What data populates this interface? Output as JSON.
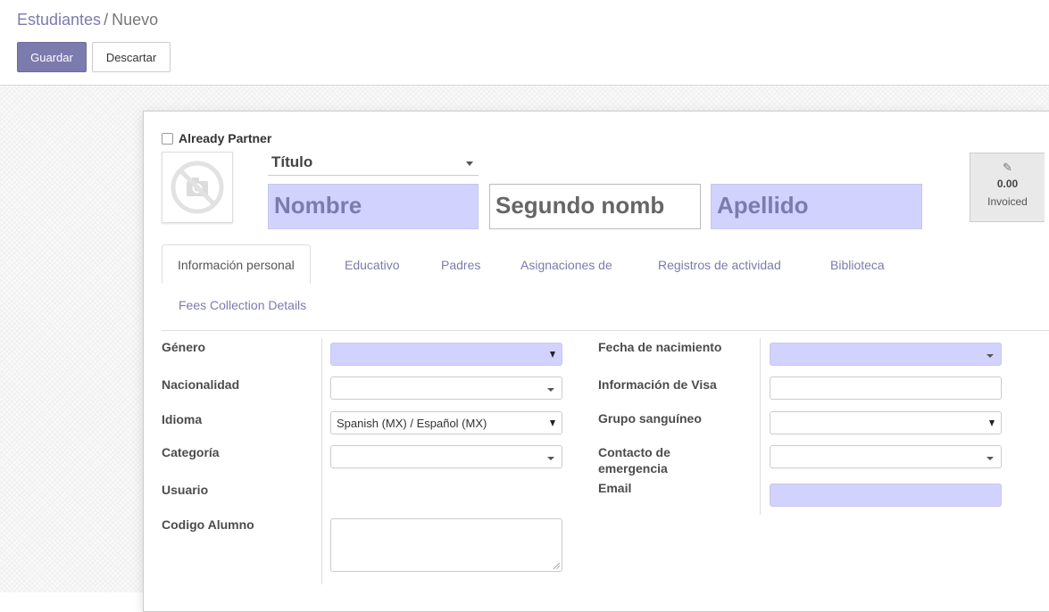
{
  "breadcrumb": {
    "parent": "Estudiantes",
    "separator": "/",
    "current": "Nuevo"
  },
  "toolbar": {
    "save_label": "Guardar",
    "discard_label": "Descartar"
  },
  "form": {
    "already_partner_label": "Already Partner",
    "already_partner_checked": false,
    "title_value": "Título",
    "first_name_placeholder": "Nombre",
    "middle_name_placeholder": "Segundo nomb",
    "last_name_placeholder": "Apellido",
    "stat": {
      "icon": "edit-icon",
      "value": "0.00",
      "label": "Invoiced"
    }
  },
  "tabs": [
    {
      "label": "Información personal",
      "active": true
    },
    {
      "label": "Educativo"
    },
    {
      "label": "Padres"
    },
    {
      "label": "Asignaciones de"
    },
    {
      "label": "Registros de actividad"
    },
    {
      "label": "Biblioteca"
    },
    {
      "label": "Fees Collection Details"
    }
  ],
  "left_fields": {
    "genero": {
      "label": "Género",
      "value": ""
    },
    "nacionalidad": {
      "label": "Nacionalidad",
      "value": ""
    },
    "idioma": {
      "label": "Idioma",
      "value": "Spanish (MX) / Español (MX)"
    },
    "categoria": {
      "label": "Categoría",
      "value": ""
    },
    "usuario": {
      "label": "Usuario"
    },
    "codigo": {
      "label": "Codigo Alumno",
      "value": ""
    }
  },
  "right_fields": {
    "fecha": {
      "label": "Fecha de nacimiento",
      "value": ""
    },
    "visa": {
      "label": "Información de Visa",
      "value": ""
    },
    "sangre": {
      "label": "Grupo sanguíneo",
      "value": ""
    },
    "contacto": {
      "label": "Contacto de emergencia",
      "value": ""
    },
    "email": {
      "label": "Email",
      "value": ""
    }
  },
  "colors": {
    "accent": "#7c7bad",
    "required_bg": "#d2d2ff"
  }
}
